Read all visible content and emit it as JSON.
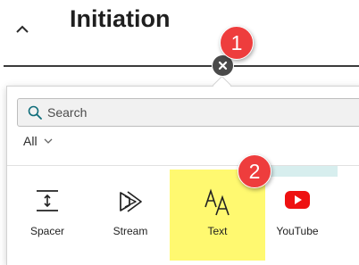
{
  "section": {
    "title": "Initiation",
    "collapse_icon": "chevron-up-icon"
  },
  "close_button": {
    "icon": "close-icon"
  },
  "toolbox": {
    "search": {
      "placeholder": "Search",
      "value": ""
    },
    "filter": {
      "selected": "All"
    },
    "web_parts": [
      {
        "label": "Spacer",
        "icon": "spacer-icon",
        "highlighted": false
      },
      {
        "label": "Stream",
        "icon": "stream-icon",
        "highlighted": false
      },
      {
        "label": "Text",
        "icon": "text-icon",
        "highlighted": true
      },
      {
        "label": "YouTube",
        "icon": "youtube-icon",
        "highlighted": false
      }
    ]
  },
  "annotations": [
    {
      "number": "1",
      "color": "#ee3d3d"
    },
    {
      "number": "2",
      "color": "#ee3d3d"
    }
  ],
  "colors": {
    "highlight": "#fff970",
    "youtube_red": "#ee1111",
    "badge_red": "#ee3d3d"
  }
}
